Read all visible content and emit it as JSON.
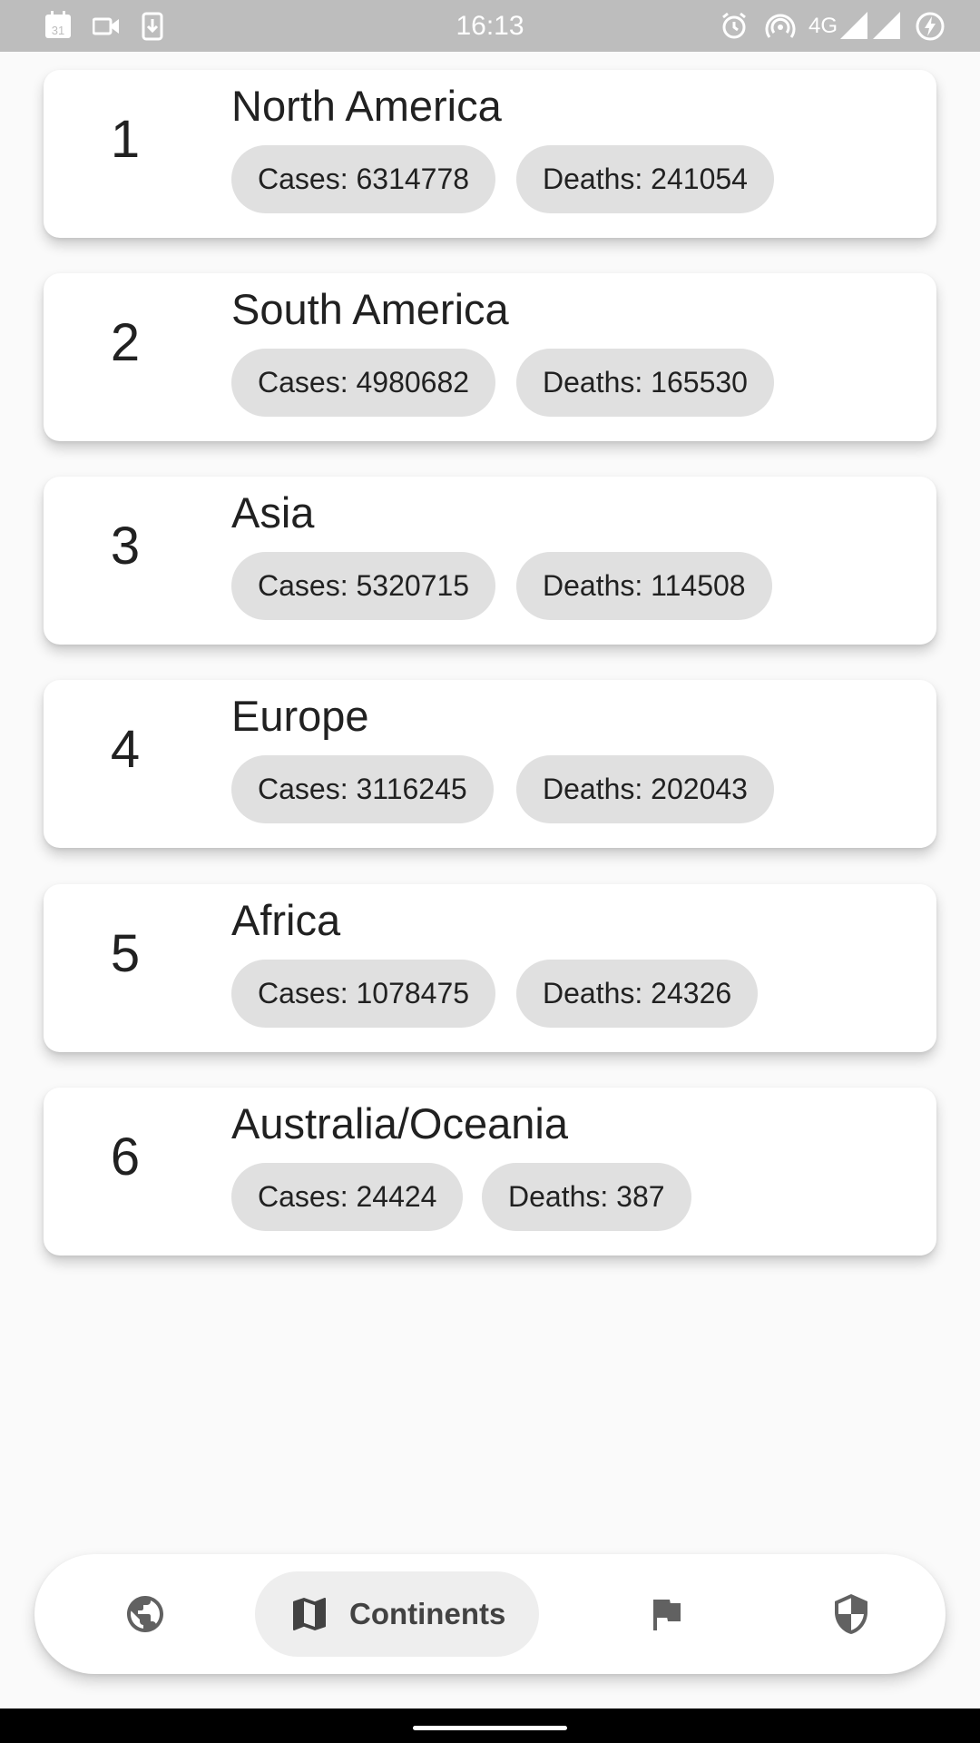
{
  "status_bar": {
    "time": "16:13",
    "calendar_day": "31",
    "network": "4G",
    "left_icons": [
      "calendar-icon",
      "video-camera-icon",
      "download-icon"
    ],
    "right_icons": [
      "alarm-icon",
      "hotspot-icon",
      "signal-icon",
      "signal-icon",
      "battery-charging-icon"
    ]
  },
  "continents": [
    {
      "rank": "1",
      "name": "North America",
      "cases": "Cases: 6314778",
      "deaths": "Deaths: 241054"
    },
    {
      "rank": "2",
      "name": "South America",
      "cases": "Cases: 4980682",
      "deaths": "Deaths: 165530"
    },
    {
      "rank": "3",
      "name": "Asia",
      "cases": "Cases: 5320715",
      "deaths": "Deaths: 114508"
    },
    {
      "rank": "4",
      "name": "Europe",
      "cases": "Cases: 3116245",
      "deaths": "Deaths: 202043"
    },
    {
      "rank": "5",
      "name": "Africa",
      "cases": "Cases: 1078475",
      "deaths": "Deaths: 24326"
    },
    {
      "rank": "6",
      "name": "Australia/Oceania",
      "cases": "Cases: 24424",
      "deaths": "Deaths: 387"
    }
  ],
  "bottom_nav": {
    "active_label": "Continents",
    "items": [
      {
        "icon": "globe-icon",
        "active": false
      },
      {
        "icon": "map-icon",
        "active": true
      },
      {
        "icon": "flag-icon",
        "active": false
      },
      {
        "icon": "shield-icon",
        "active": false
      }
    ]
  },
  "colors": {
    "background": "#fafafa",
    "card": "#ffffff",
    "chip": "#e0e0e0",
    "status_bar": "#bdbdbd",
    "icon": "#616161"
  }
}
